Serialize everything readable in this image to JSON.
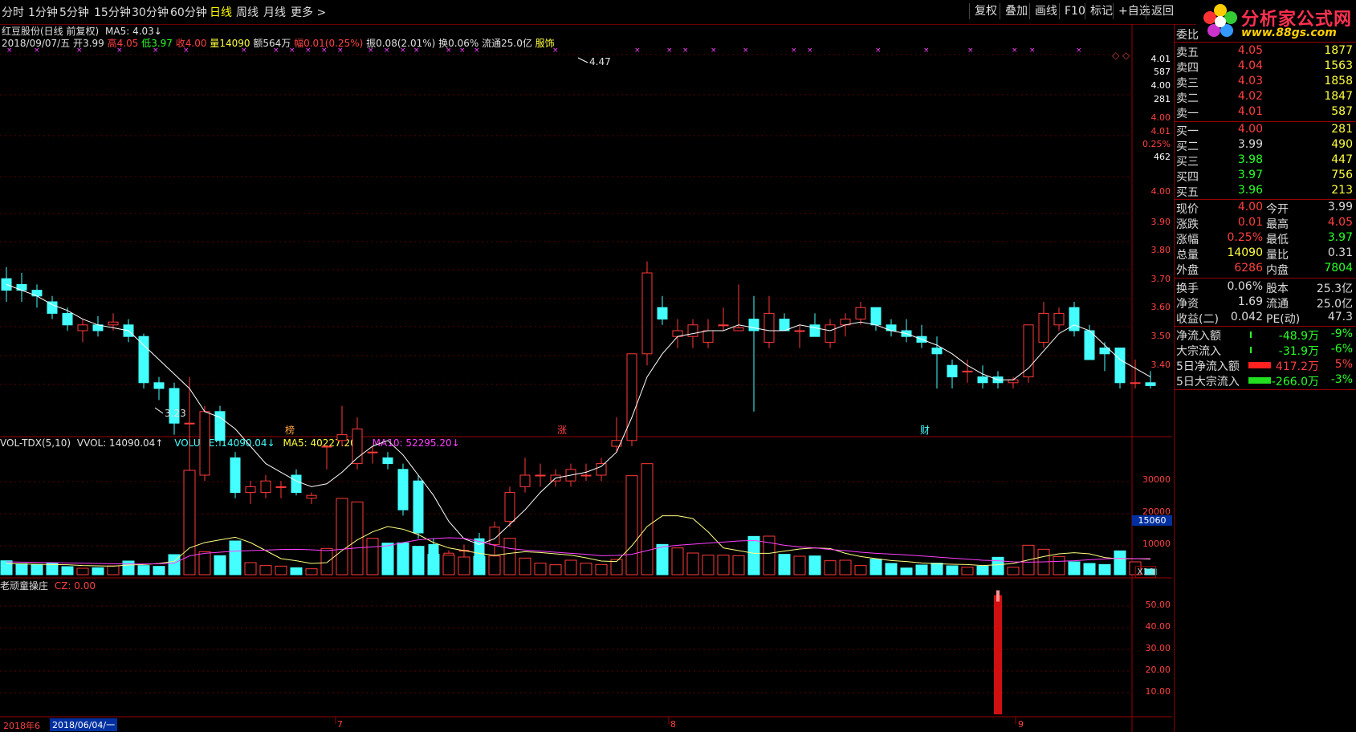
{
  "toolbar": {
    "periods": [
      "分时",
      "1分钟",
      "5分钟",
      "15分钟",
      "30分钟",
      "60分钟",
      "日线",
      "周线",
      "月线",
      "更多 >"
    ],
    "active": "日线",
    "right_buttons": [
      "复权",
      "叠加",
      "画线",
      "F10",
      "标记",
      "+自选",
      "返回"
    ]
  },
  "logo": {
    "name": "分析家公式网",
    "url": "www.88gs.com"
  },
  "header": {
    "title": "红豆股份(日线 前复权)",
    "ma_label": "MA5: 4.03↓",
    "date": "2018/09/07/五",
    "open_label": "开",
    "open": "3.99",
    "high_label": "高",
    "high": "4.05",
    "low_label": "低",
    "low": "3.97",
    "close_label": "收",
    "close": "4.00",
    "vol_label": "量",
    "vol": "14090",
    "amount": "额564万",
    "range_label": "幅",
    "range": "0.01(0.25%)",
    "swing": "振0.08(2.01%)",
    "turnover": "换0.06%",
    "float": "流通25.0亿",
    "industry": "服饰"
  },
  "price_axis": [
    "4.01",
    "587",
    "4.00",
    "281",
    "4.00",
    "4.01",
    "0.25%",
    "462",
    "4.00",
    "3.90",
    "3.80",
    "3.70",
    "3.60",
    "3.50",
    "3.40"
  ],
  "annotations": {
    "high_mark": "4.47",
    "low_mark": "3.23",
    "markers": [
      "榜",
      "涨",
      "财"
    ]
  },
  "vol_header": {
    "name": "VOL-TDX(5,10)",
    "wvol": "VVOL: 14090.04↑",
    "volume": "VOLUME: 14090.04↓",
    "ma5": "MA5: 40227.20↓",
    "ma10": "MA10: 52295.20↓"
  },
  "vol_axis": [
    "30000",
    "20000",
    "10000",
    "15060",
    "X10"
  ],
  "cz_header": {
    "name": "老顽童操庄",
    "value": "CZ: 0.00"
  },
  "cz_axis": [
    "50.00",
    "40.00",
    "30.00",
    "20.00",
    "10.00"
  ],
  "x_axis": {
    "start": "2018年6",
    "cursor": "2018/06/04/一",
    "months": [
      "7",
      "8",
      "9"
    ]
  },
  "quote": {
    "header": "委比",
    "asks": [
      {
        "label": "卖五",
        "price": "4.05",
        "vol": "1877"
      },
      {
        "label": "卖四",
        "price": "4.04",
        "vol": "1563"
      },
      {
        "label": "卖三",
        "price": "4.03",
        "vol": "1858"
      },
      {
        "label": "卖二",
        "price": "4.02",
        "vol": "1847"
      },
      {
        "label": "卖一",
        "price": "4.01",
        "vol": "587"
      }
    ],
    "bids": [
      {
        "label": "买一",
        "price": "4.00",
        "vol": "281"
      },
      {
        "label": "买二",
        "price": "3.99",
        "vol": "490"
      },
      {
        "label": "买三",
        "price": "3.98",
        "vol": "447"
      },
      {
        "label": "买四",
        "price": "3.97",
        "vol": "756"
      },
      {
        "label": "买五",
        "price": "3.96",
        "vol": "213"
      }
    ],
    "stats": [
      {
        "l1": "现价",
        "v1": "4.00",
        "l2": "今开",
        "v2": "3.99"
      },
      {
        "l1": "涨跌",
        "v1": "0.01",
        "l2": "最高",
        "v2": "4.05"
      },
      {
        "l1": "涨幅",
        "v1": "0.25%",
        "l2": "最低",
        "v2": "3.97"
      },
      {
        "l1": "总量",
        "v1": "14090",
        "l2": "量比",
        "v2": "0.31"
      },
      {
        "l1": "外盘",
        "v1": "6286",
        "l2": "内盘",
        "v2": "7804"
      }
    ],
    "stats2": [
      {
        "l1": "换手",
        "v1": "0.06%",
        "l2": "股本",
        "v2": "25.3亿"
      },
      {
        "l1": "净资",
        "v1": "1.69",
        "l2": "流通",
        "v2": "25.0亿"
      },
      {
        "l1": "收益(二)",
        "v1": "0.042",
        "l2": "PE(动)",
        "v2": "47.3"
      }
    ],
    "flows": [
      {
        "label": "净流入额",
        "value": "-48.9万",
        "pct": "-9%"
      },
      {
        "label": "大宗流入",
        "value": "-31.9万",
        "pct": "-6%"
      },
      {
        "label": "5日净流入额",
        "value": "417.2万",
        "pct": "5%"
      },
      {
        "label": "5日大宗流入",
        "value": "-266.0万",
        "pct": "-3%"
      }
    ]
  },
  "colors": {
    "up": "#ff3a3a",
    "down": "#44ffff",
    "ma": "#ffffff",
    "vol_ma5": "#ffff80",
    "vol_ma10": "#ff40ff",
    "grid": "#800000"
  },
  "chart_data": {
    "type": "candlestick",
    "price_range": [
      3.2,
      4.5
    ],
    "candles": [
      {
        "o": 3.68,
        "h": 3.72,
        "l": 3.6,
        "c": 3.64,
        "v": 5200
      },
      {
        "o": 3.66,
        "h": 3.7,
        "l": 3.6,
        "c": 3.64,
        "v": 4100
      },
      {
        "o": 3.64,
        "h": 3.66,
        "l": 3.58,
        "c": 3.62,
        "v": 3800
      },
      {
        "o": 3.6,
        "h": 3.62,
        "l": 3.54,
        "c": 3.56,
        "v": 4200
      },
      {
        "o": 3.56,
        "h": 3.58,
        "l": 3.5,
        "c": 3.52,
        "v": 3000
      },
      {
        "o": 3.5,
        "h": 3.54,
        "l": 3.46,
        "c": 3.52,
        "v": 2400
      },
      {
        "o": 3.52,
        "h": 3.55,
        "l": 3.48,
        "c": 3.5,
        "v": 2600
      },
      {
        "o": 3.52,
        "h": 3.56,
        "l": 3.5,
        "c": 3.53,
        "v": 3300
      },
      {
        "o": 3.52,
        "h": 3.54,
        "l": 3.46,
        "c": 3.48,
        "v": 5100
      },
      {
        "o": 3.48,
        "h": 3.49,
        "l": 3.3,
        "c": 3.32,
        "v": 3400
      },
      {
        "o": 3.32,
        "h": 3.34,
        "l": 3.26,
        "c": 3.3,
        "v": 3100
      },
      {
        "o": 3.3,
        "h": 3.32,
        "l": 3.14,
        "c": 3.18,
        "v": 7500
      },
      {
        "o": 3.18,
        "h": 3.34,
        "l": 2.88,
        "c": 3.18,
        "v": 39000
      },
      {
        "o": 3.0,
        "h": 3.24,
        "l": 2.98,
        "c": 3.22,
        "v": 8600
      },
      {
        "o": 3.22,
        "h": 3.24,
        "l": 3.1,
        "c": 3.12,
        "v": 7100
      },
      {
        "o": 3.06,
        "h": 3.08,
        "l": 2.92,
        "c": 2.94,
        "v": 12600
      },
      {
        "o": 2.94,
        "h": 2.98,
        "l": 2.9,
        "c": 2.96,
        "v": 4500
      },
      {
        "o": 2.94,
        "h": 3.0,
        "l": 2.92,
        "c": 2.98,
        "v": 3400
      },
      {
        "o": 2.96,
        "h": 2.98,
        "l": 2.92,
        "c": 2.96,
        "v": 3200
      },
      {
        "o": 3.0,
        "h": 3.02,
        "l": 2.93,
        "c": 2.94,
        "v": 2600
      },
      {
        "o": 2.92,
        "h": 2.94,
        "l": 2.9,
        "c": 2.93,
        "v": 2200
      },
      {
        "o": 3.1,
        "h": 3.1,
        "l": 3.02,
        "c": 3.1,
        "v": 9800
      },
      {
        "o": 3.12,
        "h": 3.24,
        "l": 3.1,
        "c": 3.14,
        "v": 28500
      },
      {
        "o": 3.04,
        "h": 3.2,
        "l": 3.02,
        "c": 3.16,
        "v": 27200
      },
      {
        "o": 3.08,
        "h": 3.1,
        "l": 3.04,
        "c": 3.08,
        "v": 13600
      },
      {
        "o": 3.06,
        "h": 3.08,
        "l": 3.02,
        "c": 3.04,
        "v": 11800
      },
      {
        "o": 3.02,
        "h": 3.04,
        "l": 2.86,
        "c": 2.88,
        "v": 11900
      },
      {
        "o": 2.98,
        "h": 3.0,
        "l": 2.78,
        "c": 2.8,
        "v": 10600
      },
      {
        "o": 2.76,
        "h": 2.78,
        "l": 2.68,
        "c": 2.7,
        "v": 7600
      },
      {
        "o": 2.7,
        "h": 2.74,
        "l": 2.66,
        "c": 2.73,
        "v": 7300
      },
      {
        "o": 2.74,
        "h": 2.76,
        "l": 2.68,
        "c": 2.74,
        "v": 6600
      },
      {
        "o": 2.78,
        "h": 2.8,
        "l": 2.7,
        "c": 2.72,
        "v": 6800
      },
      {
        "o": 2.76,
        "h": 2.84,
        "l": 2.66,
        "c": 2.82,
        "v": 7000
      },
      {
        "o": 2.84,
        "h": 2.96,
        "l": 2.82,
        "c": 2.94,
        "v": 13600
      },
      {
        "o": 2.96,
        "h": 3.06,
        "l": 2.94,
        "c": 3.0,
        "v": 6200
      },
      {
        "o": 3.0,
        "h": 3.04,
        "l": 2.96,
        "c": 3.0,
        "v": 4300
      },
      {
        "o": 2.98,
        "h": 3.02,
        "l": 2.96,
        "c": 3.0,
        "v": 3700
      },
      {
        "o": 2.98,
        "h": 3.04,
        "l": 2.96,
        "c": 3.02,
        "v": 5400
      },
      {
        "o": 3.0,
        "h": 3.04,
        "l": 2.98,
        "c": 3.0,
        "v": 4300
      },
      {
        "o": 3.0,
        "h": 3.06,
        "l": 2.98,
        "c": 3.04,
        "v": 3800
      },
      {
        "o": 3.1,
        "h": 3.2,
        "l": 3.08,
        "c": 3.12,
        "v": 5700
      },
      {
        "o": 3.12,
        "h": 3.42,
        "l": 3.1,
        "c": 3.42,
        "v": 37000
      },
      {
        "o": 3.42,
        "h": 3.74,
        "l": 3.38,
        "c": 3.7,
        "v": 41500
      },
      {
        "o": 3.58,
        "h": 3.62,
        "l": 3.52,
        "c": 3.54,
        "v": 11300
      },
      {
        "o": 3.48,
        "h": 3.54,
        "l": 3.44,
        "c": 3.5,
        "v": 10000
      },
      {
        "o": 3.48,
        "h": 3.54,
        "l": 3.44,
        "c": 3.52,
        "v": 8100
      },
      {
        "o": 3.46,
        "h": 3.54,
        "l": 3.44,
        "c": 3.5,
        "v": 7300
      },
      {
        "o": 3.52,
        "h": 3.58,
        "l": 3.5,
        "c": 3.52,
        "v": 7300
      },
      {
        "o": 3.5,
        "h": 3.66,
        "l": 3.5,
        "c": 3.51,
        "v": 7100
      },
      {
        "o": 3.54,
        "h": 3.62,
        "l": 3.22,
        "c": 3.5,
        "v": 14300
      },
      {
        "o": 3.46,
        "h": 3.62,
        "l": 3.44,
        "c": 3.56,
        "v": 14400
      },
      {
        "o": 3.54,
        "h": 3.56,
        "l": 3.5,
        "c": 3.5,
        "v": 7600
      },
      {
        "o": 3.5,
        "h": 3.52,
        "l": 3.44,
        "c": 3.5,
        "v": 6900
      },
      {
        "o": 3.52,
        "h": 3.56,
        "l": 3.48,
        "c": 3.48,
        "v": 7000
      },
      {
        "o": 3.46,
        "h": 3.54,
        "l": 3.44,
        "c": 3.52,
        "v": 5200
      },
      {
        "o": 3.52,
        "h": 3.56,
        "l": 3.48,
        "c": 3.54,
        "v": 5400
      },
      {
        "o": 3.54,
        "h": 3.6,
        "l": 3.52,
        "c": 3.58,
        "v": 3400
      },
      {
        "o": 3.58,
        "h": 3.58,
        "l": 3.5,
        "c": 3.52,
        "v": 5800
      },
      {
        "o": 3.52,
        "h": 3.54,
        "l": 3.48,
        "c": 3.5,
        "v": 4200
      },
      {
        "o": 3.5,
        "h": 3.54,
        "l": 3.46,
        "c": 3.48,
        "v": 2500
      },
      {
        "o": 3.48,
        "h": 3.52,
        "l": 3.44,
        "c": 3.46,
        "v": 3600
      },
      {
        "o": 3.44,
        "h": 3.48,
        "l": 3.3,
        "c": 3.42,
        "v": 4300
      },
      {
        "o": 3.38,
        "h": 3.4,
        "l": 3.3,
        "c": 3.34,
        "v": 3300
      },
      {
        "o": 3.36,
        "h": 3.4,
        "l": 3.32,
        "c": 3.36,
        "v": 2800
      },
      {
        "o": 3.34,
        "h": 3.38,
        "l": 3.3,
        "c": 3.32,
        "v": 3200
      },
      {
        "o": 3.34,
        "h": 3.36,
        "l": 3.3,
        "c": 3.32,
        "v": 6500
      },
      {
        "o": 3.32,
        "h": 3.34,
        "l": 3.3,
        "c": 3.33,
        "v": 2800
      },
      {
        "o": 3.34,
        "h": 3.52,
        "l": 3.32,
        "c": 3.52,
        "v": 11000
      },
      {
        "o": 3.46,
        "h": 3.6,
        "l": 3.44,
        "c": 3.56,
        "v": 9500
      },
      {
        "o": 3.52,
        "h": 3.58,
        "l": 3.5,
        "c": 3.56,
        "v": 6800
      },
      {
        "o": 3.58,
        "h": 3.6,
        "l": 3.48,
        "c": 3.5,
        "v": 4800
      },
      {
        "o": 3.5,
        "h": 3.52,
        "l": 3.4,
        "c": 3.4,
        "v": 4200
      },
      {
        "o": 3.44,
        "h": 3.46,
        "l": 3.36,
        "c": 3.42,
        "v": 3800
      },
      {
        "o": 3.44,
        "h": 3.44,
        "l": 3.3,
        "c": 3.32,
        "v": 8900
      },
      {
        "o": 3.32,
        "h": 3.4,
        "l": 3.3,
        "c": 3.32,
        "v": 4800
      },
      {
        "o": 3.32,
        "h": 3.36,
        "l": 3.3,
        "c": 3.31,
        "v": 2100
      }
    ],
    "ma5": [
      3.66,
      3.64,
      3.62,
      3.59,
      3.57,
      3.54,
      3.52,
      3.51,
      3.5,
      3.45,
      3.4,
      3.35,
      3.3,
      3.22,
      3.2,
      3.16,
      3.1,
      3.04,
      3.01,
      2.98,
      2.96,
      2.97,
      3.01,
      3.06,
      3.1,
      3.12,
      3.07,
      3.0,
      2.93,
      2.84,
      2.78,
      2.76,
      2.78,
      2.83,
      2.88,
      2.94,
      2.99,
      3.0,
      3.01,
      3.03,
      3.08,
      3.2,
      3.34,
      3.42,
      3.48,
      3.49,
      3.5,
      3.5,
      3.52,
      3.51,
      3.5,
      3.5,
      3.52,
      3.51,
      3.5,
      3.52,
      3.53,
      3.52,
      3.5,
      3.49,
      3.47,
      3.45,
      3.42,
      3.38,
      3.35,
      3.33,
      3.33,
      3.37,
      3.43,
      3.49,
      3.52,
      3.5,
      3.45,
      3.4,
      3.37,
      3.34
    ],
    "vol_ma5": [
      4200,
      4000,
      3900,
      3800,
      3700,
      3400,
      3300,
      3200,
      3600,
      3800,
      4200,
      5000,
      10000,
      12000,
      13000,
      14000,
      12000,
      9000,
      6000,
      5200,
      4200,
      4500,
      9000,
      13000,
      16000,
      18000,
      17000,
      15000,
      12000,
      10000,
      9000,
      8000,
      7200,
      8000,
      8600,
      8300,
      7800,
      7300,
      6300,
      5100,
      4900,
      10800,
      18000,
      22000,
      22000,
      21000,
      16000,
      10000,
      9000,
      8000,
      8000,
      8800,
      9600,
      10000,
      9800,
      8000,
      6800,
      6000,
      5300,
      4900,
      4400,
      4100,
      3900,
      3800,
      3400,
      3700,
      4200,
      5500,
      6800,
      7800,
      8200,
      7800,
      6400,
      5900,
      6000,
      5800
    ],
    "vol_ma10": [
      4800,
      4700,
      4600,
      4500,
      4400,
      4300,
      4200,
      4100,
      4000,
      4000,
      4100,
      4300,
      7000,
      8000,
      8400,
      8800,
      9000,
      9200,
      9400,
      9500,
      9300,
      9000,
      9500,
      10000,
      10400,
      10800,
      12000,
      13000,
      13500,
      13800,
      13600,
      12400,
      11000,
      9800,
      9200,
      8800,
      8400,
      8000,
      7600,
      7100,
      7200,
      7600,
      9000,
      10400,
      11000,
      11400,
      11800,
      12200,
      12600,
      12800,
      12000,
      11000,
      10400,
      10000,
      9400,
      9000,
      8400,
      8000,
      7700,
      7400,
      7000,
      6600,
      6200,
      5800,
      5400,
      5200,
      4800,
      4700,
      4800,
      5000,
      5200,
      5600,
      5900,
      6100,
      6000,
      6000
    ],
    "cz_values": {
      "index": 65,
      "value": 55
    }
  }
}
